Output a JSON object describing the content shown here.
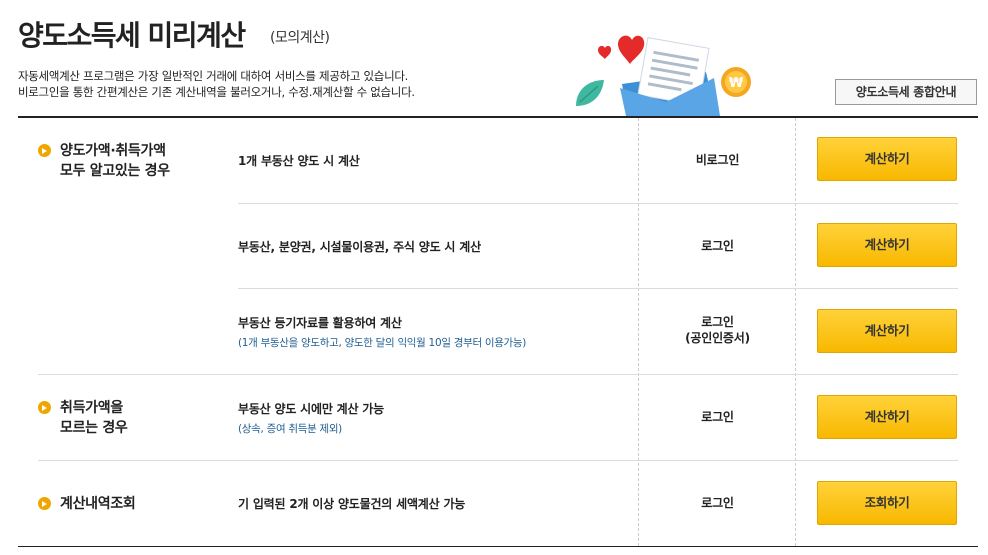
{
  "header": {
    "title": "양도소득세 미리계산",
    "subtitle": "(모의계산)",
    "intro_line1": "자동세액계산 프로그램은 가장 일반적인 거래에 대하여 서비스를 제공하고 있습니다.",
    "intro_line2": "비로그인을 통한 간편계산은 기존 계산내역을 불러오거나, 수정.재계산할 수 없습니다.",
    "guide_button": "양도소득세 종합안내"
  },
  "categories": [
    {
      "line1": "양도가액·취득가액",
      "line2": "모두 알고있는 경우"
    },
    {
      "line1": "취득가액을",
      "line2": "모르는 경우"
    },
    {
      "line1": "계산내역조회",
      "line2": ""
    }
  ],
  "rows": [
    {
      "desc": "1개 부동산 양도 시 계산",
      "note": "",
      "auth_line1": "비로그인",
      "auth_line2": "",
      "button": "계산하기"
    },
    {
      "desc": "부동산, 분양권, 시설물이용권, 주식 양도 시 계산",
      "note": "",
      "auth_line1": "로그인",
      "auth_line2": "",
      "button": "계산하기"
    },
    {
      "desc": "부동산 등기자료를 활용하여 계산",
      "note": "(1개 부동산을 양도하고, 양도한 달의 익익월 10일 경부터 이용가능)",
      "auth_line1": "로그인",
      "auth_line2": "(공인인증서)",
      "button": "계산하기"
    },
    {
      "desc": "부동산 양도 시에만 계산 가능",
      "note": "(상속, 증여 취득분 제외)",
      "auth_line1": "로그인",
      "auth_line2": "",
      "button": "계산하기"
    },
    {
      "desc": "기 입력된 2개 이상 양도물건의 세액계산 가능",
      "note": "",
      "auth_line1": "로그인",
      "auth_line2": "",
      "button": "조회하기"
    }
  ],
  "colors": {
    "accent_button": "#f8c200",
    "bullet": "#f0a500",
    "note_text": "#1f5f93"
  },
  "icons": {
    "illustration": "heart-envelope-coin-illustration",
    "bullet": "orange-arrow-bullet-icon"
  }
}
